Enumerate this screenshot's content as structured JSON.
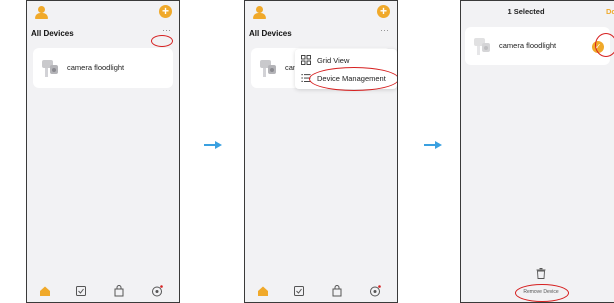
{
  "panels": {
    "p1": {
      "section_title": "All Devices",
      "more_glyph": "···",
      "device_label": "camera floodlight"
    },
    "p2": {
      "section_title": "All Devices",
      "more_glyph": "···",
      "device_label_partial": "came",
      "menu": {
        "grid_view_label": "Grid View",
        "device_management_label": "Device Management"
      }
    },
    "p3": {
      "selected_title": "1 Selected",
      "done_label": "Do",
      "device_label": "camera floodlight",
      "remove_label": "Remove Device"
    }
  },
  "icons": {
    "avatar": "user-icon",
    "add": "plus-icon",
    "grid": "grid-icon",
    "list": "list-icon",
    "home": "home-icon",
    "scene": "scene-icon",
    "mall": "bag-icon",
    "me": "me-icon",
    "trash": "trash-icon",
    "check": "check-icon",
    "arrow": "right-arrow-icon"
  },
  "colors": {
    "accent": "#f0a92a",
    "annotation": "#d62020",
    "arrow": "#3aa0e0",
    "background": "#f2f2f4"
  }
}
